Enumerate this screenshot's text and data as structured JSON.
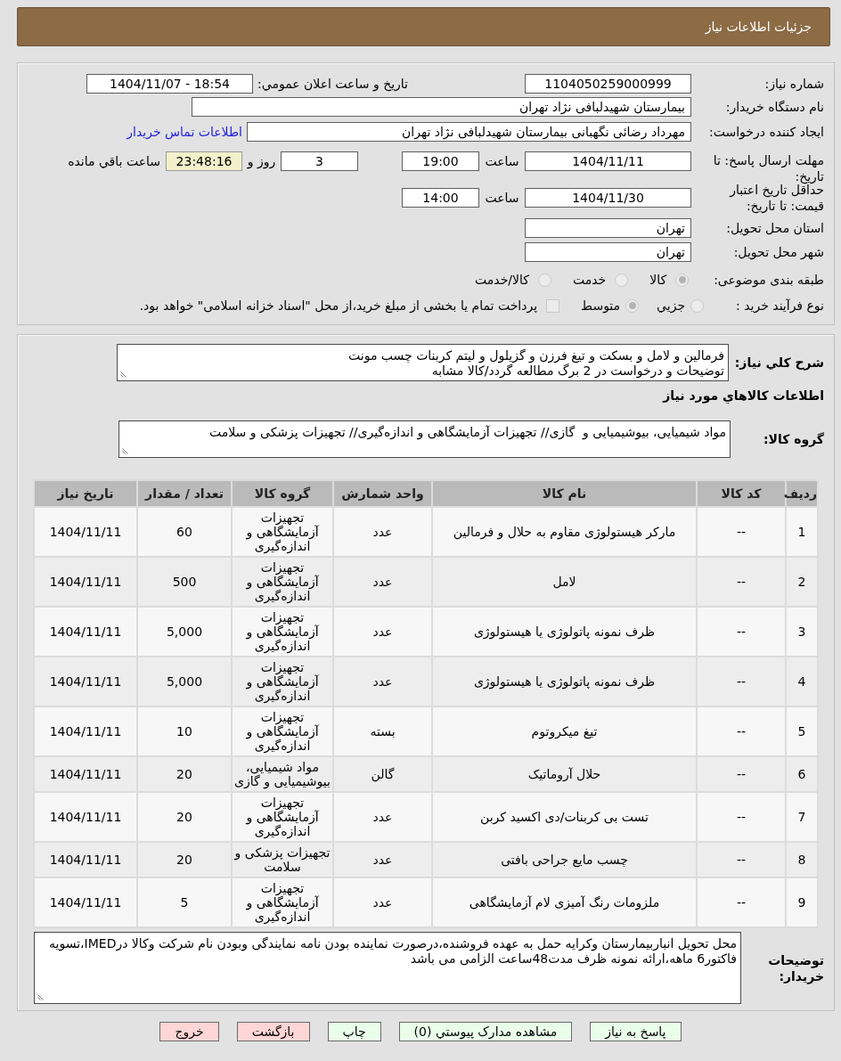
{
  "header": {
    "title": "جزئیات اطلاعات نیاز"
  },
  "general": {
    "need_number": {
      "label": "شماره نیاز:",
      "value": "1104050259000999"
    },
    "announcement": {
      "label": "تاریخ و ساعت اعلان عمومي:",
      "value": "1404/11/07 - 18:54"
    },
    "buyer_org": {
      "label": "نام دستگاه خریدار:",
      "value": "بیمارستان شهیدلبافی نژاد تهران"
    },
    "requester": {
      "label": "ایجاد کننده درخواست:",
      "value": "مهرداد رضائی نگهبانی بیمارستان شهیدلبافی نژاد تهران",
      "contact_link": "اطلاعات تماس خریدار"
    },
    "reply_deadline": {
      "label": "مهلت ارسال پاسخ: تا تاریخ:",
      "date": "1404/11/11",
      "time_label": "ساعت",
      "time": "19:00",
      "days": "3",
      "days_label": "روز و",
      "remaining": "23:48:16",
      "remaining_label": "ساعت باقي مانده"
    },
    "price_validity": {
      "label": "حداقل تاریخ اعتبار قیمت: تا تاریخ:",
      "date": "1404/11/30",
      "time_label": "ساعت",
      "time": "14:00"
    },
    "delivery_province": {
      "label": "استان محل تحویل:",
      "value": "تهران"
    },
    "delivery_city": {
      "label": "شهر محل تحویل:",
      "value": "تهران"
    },
    "subject_category": {
      "label": "طبقه بندی موضوعی:",
      "options": [
        {
          "label": "کالا",
          "selected": true
        },
        {
          "label": "خدمت",
          "selected": false
        },
        {
          "label": "کالا/خدمت",
          "selected": false
        }
      ]
    },
    "purchase_process": {
      "label": "نوع فرآیند خرید :",
      "options": [
        {
          "label": "جزيي",
          "selected": false
        },
        {
          "label": "متوسط",
          "selected": true
        }
      ],
      "treasury_payment": {
        "label": "پرداخت تمام یا بخشی از مبلغ خرید،از محل \"اسناد خزانه اسلامی\" خواهد بود.",
        "checked": false
      }
    }
  },
  "details": {
    "description": {
      "label": "شرح کلي نیاز:",
      "value": "فرمالین و لامل و بسکت و تیغ فرزن و گزیلول و لیتم کربنات چسب مونت\nتوضیحات و درخواست در 2 برگ مطالعه گردد/کالا مشابه"
    },
    "goods_heading": "اطلاعات کالاهاي مورد نیاز",
    "goods_group": {
      "label": "گروه کالا:",
      "value": "مواد شیمیایی، بیوشیمیایی و  گازی// تجهیزات آزمایشگاهی و اندازه‌گیری// تجهیزات پزشکی و سلامت"
    },
    "table": {
      "columns": [
        "ردیف",
        "کد کالا",
        "نام کالا",
        "واحد شمارش",
        "گروه کالا",
        "تعداد / مقدار",
        "تاریخ نیاز"
      ],
      "rows": [
        {
          "row": "1",
          "code": "--",
          "name": "مارکر هیستولوژی مقاوم به حلال و فرمالین",
          "unit": "عدد",
          "group": "تجهیزات آزمایشگاهی و اندازه‌گیری",
          "quantity": "60",
          "date": "1404/11/11"
        },
        {
          "row": "2",
          "code": "--",
          "name": "لامل",
          "unit": "عدد",
          "group": "تجهیزات آزمایشگاهی و اندازه‌گیری",
          "quantity": "500",
          "date": "1404/11/11"
        },
        {
          "row": "3",
          "code": "--",
          "name": "ظرف نمونه پاتولوژی یا هیستولوژی",
          "unit": "عدد",
          "group": "تجهیزات آزمایشگاهی و اندازه‌گیری",
          "quantity": "5,000",
          "date": "1404/11/11"
        },
        {
          "row": "4",
          "code": "--",
          "name": "ظرف نمونه پاتولوژی یا هیستولوژی",
          "unit": "عدد",
          "group": "تجهیزات آزمایشگاهی و اندازه‌گیری",
          "quantity": "5,000",
          "date": "1404/11/11"
        },
        {
          "row": "5",
          "code": "--",
          "name": "تیغ میکروتوم",
          "unit": "بسته",
          "group": "تجهیزات آزمایشگاهی و اندازه‌گیری",
          "quantity": "10",
          "date": "1404/11/11"
        },
        {
          "row": "6",
          "code": "--",
          "name": "حلال آروماتیک",
          "unit": "گالن",
          "group": "مواد شیمیایی، بیوشیمیایی و گازی",
          "quantity": "20",
          "date": "1404/11/11"
        },
        {
          "row": "7",
          "code": "--",
          "name": "تست بی کربنات/دی اکسید کربن",
          "unit": "عدد",
          "group": "تجهیزات آزمایشگاهی و اندازه‌گیری",
          "quantity": "20",
          "date": "1404/11/11"
        },
        {
          "row": "8",
          "code": "--",
          "name": "چسب مایع جراحی بافتی",
          "unit": "عدد",
          "group": "تجهیزات پزشکی و سلامت",
          "quantity": "20",
          "date": "1404/11/11"
        },
        {
          "row": "9",
          "code": "--",
          "name": "ملزومات رنگ آمیزی لام آزمایشگاهی",
          "unit": "عدد",
          "group": "تجهیزات آزمایشگاهی و اندازه‌گیری",
          "quantity": "5",
          "date": "1404/11/11"
        }
      ]
    },
    "buyer_notes": {
      "label": "توضیحات خریدار:",
      "value": "محل تحویل انباربیمارستان وکرایه حمل به عهده فروشنده،درصورت نماینده بودن نامه نمایندگی وبودن نام شرکت وکالا درIMED،تسویه فاکتور6 ماهه،ارائه نمونه ظرف مدت48ساعت الزامی می باشد"
    }
  },
  "buttons": [
    {
      "label": "پاسخ به نیاز",
      "kind": "action"
    },
    {
      "label": "مشاهده مدارک پیوستي (0)",
      "kind": "action"
    },
    {
      "label": "چاپ",
      "kind": "action"
    },
    {
      "label": "بازگشت",
      "kind": "leave"
    },
    {
      "label": "خروج",
      "kind": "leave"
    }
  ]
}
